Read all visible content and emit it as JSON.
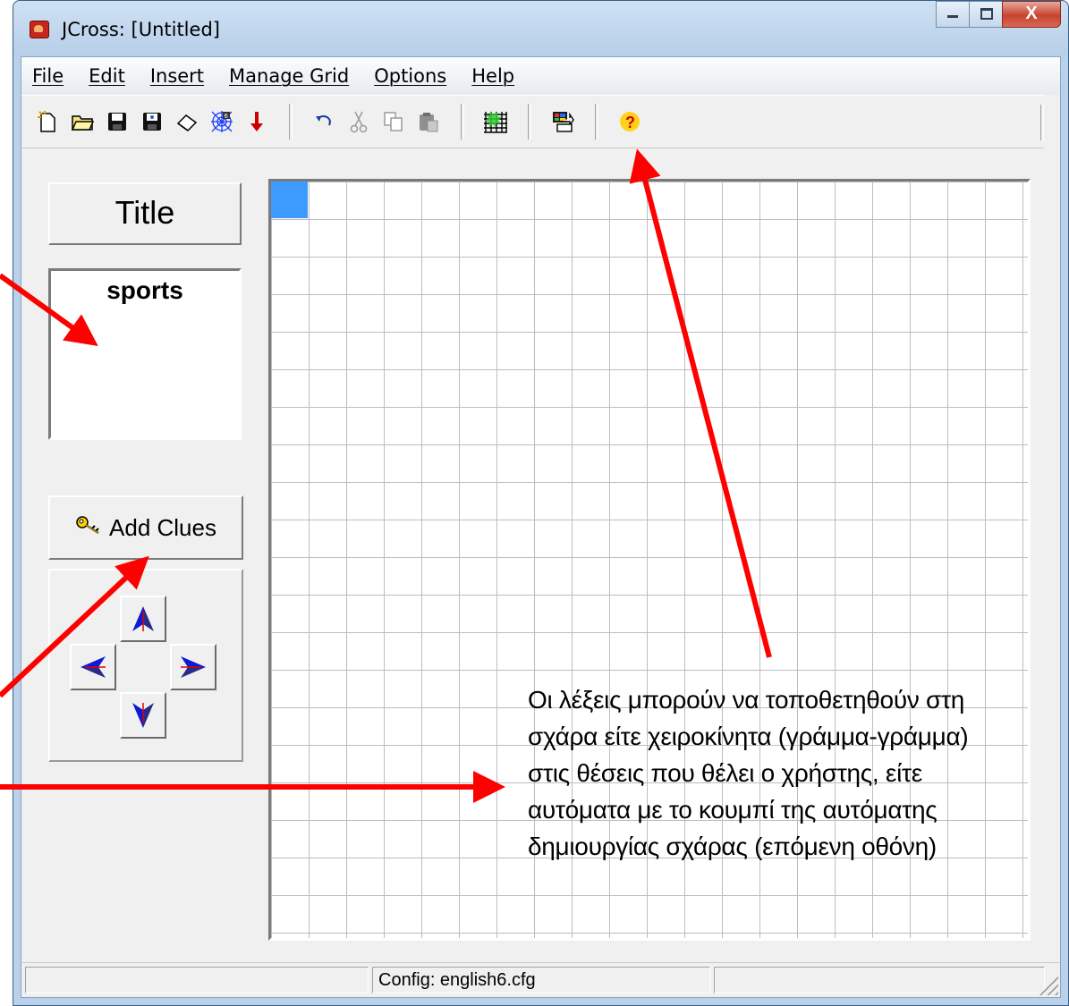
{
  "window": {
    "title": "JCross: [Untitled]",
    "close_glyph": "X"
  },
  "menubar": {
    "items": [
      "File",
      "Edit",
      "Insert",
      "Manage Grid",
      "Options",
      "Help"
    ]
  },
  "toolbar": {
    "icons": [
      "new-file-icon",
      "open-folder-icon",
      "save-icon",
      "save-as-icon",
      "eraser-icon",
      "grid-web-icon",
      "arrow-down-icon",
      "undo-icon",
      "cut-icon",
      "copy-icon",
      "paste-icon",
      "auto-grid-icon",
      "export-icon",
      "help-icon"
    ]
  },
  "left_panel": {
    "title_button": "Title",
    "title_value": "sports",
    "add_clues_button": "Add Clues"
  },
  "grid": {
    "rows": 20,
    "cols": 20,
    "selected_cell": [
      1,
      1
    ],
    "selected_color": "#3d9bff"
  },
  "statusbar": {
    "config": "Config: english6.cfg"
  },
  "annotation": {
    "lines": [
      "Οι λέξεις μπορούν να τοποθετηθούν στη",
      "σχάρα είτε χειροκίνητα (γράμμα-γράμμα)",
      "στις θέσεις που θέλει ο χρήστης, είτε",
      "αυτόματα με το κουμπί της αυτόματης",
      "δημιουργίας σχάρας (επόμενη οθόνη)"
    ],
    "arrow_color": "#ff0000"
  }
}
